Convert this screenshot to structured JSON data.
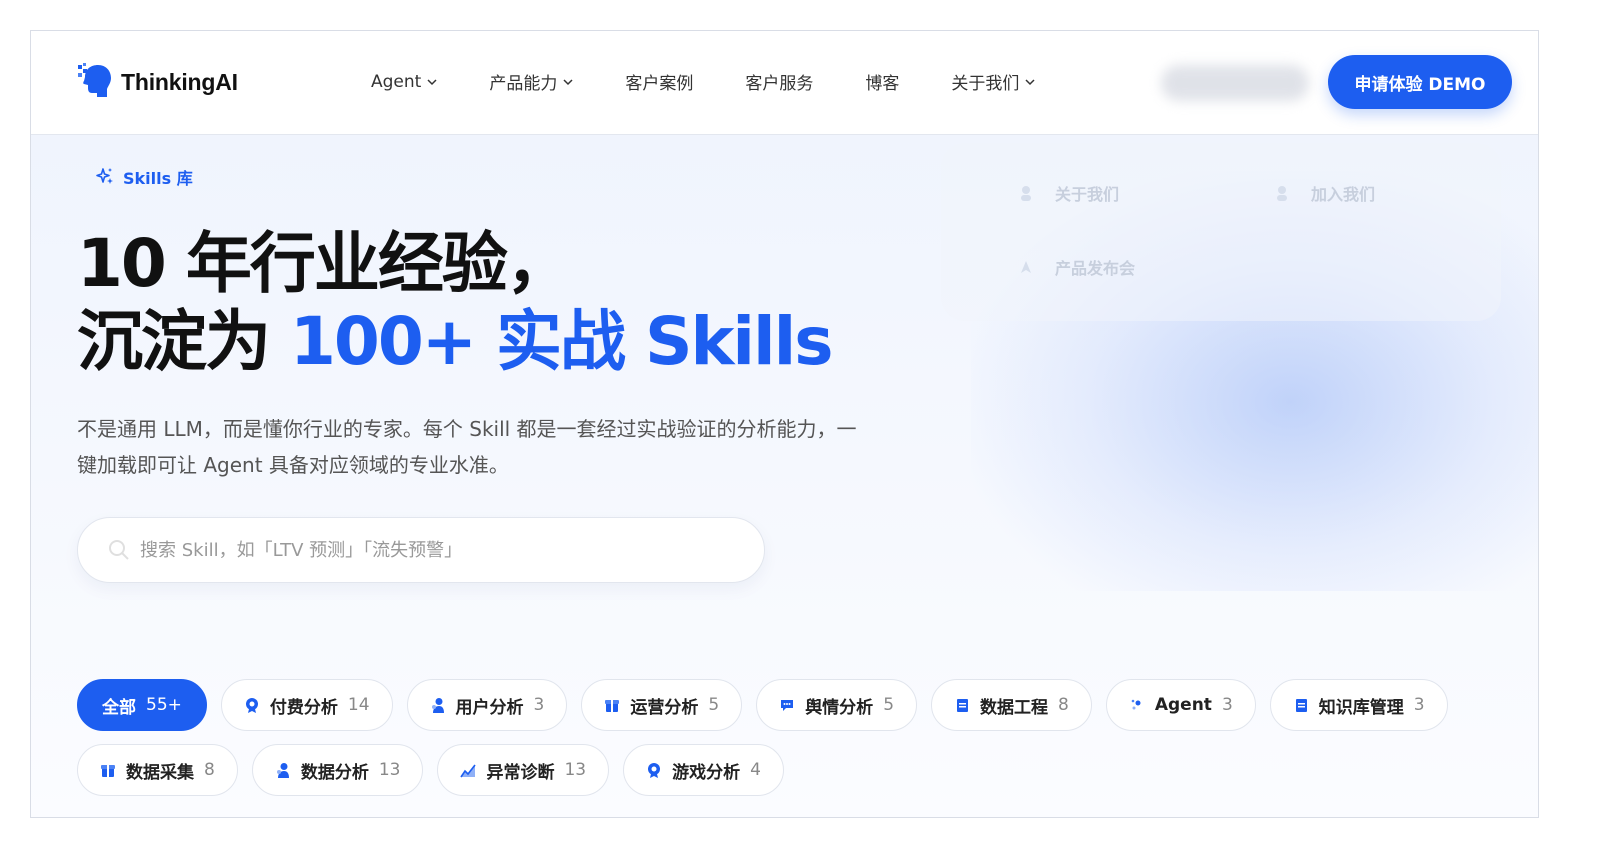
{
  "brand": {
    "name": "ThinkingAI"
  },
  "nav": {
    "items": [
      {
        "label": "Agent",
        "has_dropdown": true
      },
      {
        "label": "产品能力",
        "has_dropdown": true
      },
      {
        "label": "客户案例",
        "has_dropdown": false
      },
      {
        "label": "客户服务",
        "has_dropdown": false
      },
      {
        "label": "博客",
        "has_dropdown": false
      },
      {
        "label": "关于我们",
        "has_dropdown": true
      }
    ],
    "cta": "申请体验 DEMO"
  },
  "menu_ghost": {
    "items": [
      "关于我们",
      "加入我们",
      "产品发布会"
    ]
  },
  "hero": {
    "badge": "Skills 库",
    "title_line1": "10 年行业经验，",
    "title_line2_plain": "沉淀为 ",
    "title_line2_accent": "100+ 实战 Skills",
    "description": "不是通用 LLM，而是懂你行业的专家。每个 Skill 都是一套经过实战验证的分析能力，一键加载即可让 Agent 具备对应领域的专业水准。",
    "search_placeholder": "搜索 Skill，如「LTV 预测」「流失预警」"
  },
  "categories": {
    "row1": [
      {
        "label": "全部",
        "count": "55+",
        "active": true,
        "icon": ""
      },
      {
        "label": "付费分析",
        "count": "14",
        "active": false,
        "icon": "coin-icon"
      },
      {
        "label": "用户分析",
        "count": "3",
        "active": false,
        "icon": "user-icon"
      },
      {
        "label": "运营分析",
        "count": "5",
        "active": false,
        "icon": "gift-icon"
      },
      {
        "label": "舆情分析",
        "count": "5",
        "active": false,
        "icon": "chat-icon"
      },
      {
        "label": "数据工程",
        "count": "8",
        "active": false,
        "icon": "doc-icon"
      },
      {
        "label": "Agent",
        "count": "3",
        "active": false,
        "icon": "sparkle-icon"
      },
      {
        "label": "知识库管理",
        "count": "3",
        "active": false,
        "icon": "doc-icon"
      }
    ],
    "row2": [
      {
        "label": "数据采集",
        "count": "8",
        "active": false,
        "icon": "gift-icon"
      },
      {
        "label": "数据分析",
        "count": "13",
        "active": false,
        "icon": "user-icon"
      },
      {
        "label": "异常诊断",
        "count": "13",
        "active": false,
        "icon": "chart-icon"
      },
      {
        "label": "游戏分析",
        "count": "4",
        "active": false,
        "icon": "coin-icon"
      }
    ]
  },
  "colors": {
    "accent": "#1d5ef0",
    "text": "#111111",
    "muted": "#555555"
  }
}
